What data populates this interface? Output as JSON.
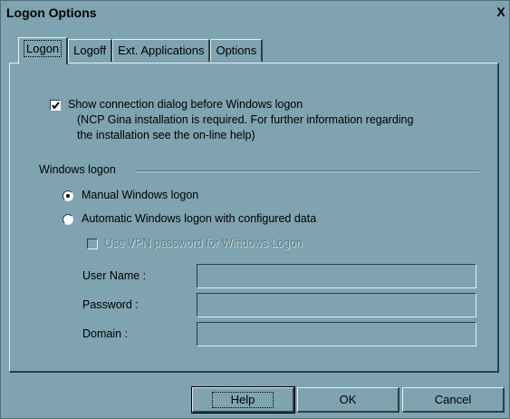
{
  "window": {
    "title": "Logon Options",
    "close_glyph": "X"
  },
  "tabs": [
    {
      "label": "Logon",
      "active": true
    },
    {
      "label": "Logoff",
      "active": false
    },
    {
      "label": "Ext. Applications",
      "active": false
    },
    {
      "label": "Options",
      "active": false
    }
  ],
  "logon": {
    "show_dialog": {
      "label": "Show connection dialog before Windows logon",
      "checked": true,
      "note_line1": "(NCP Gina installation is required. For further information regarding",
      "note_line2": "the installation see the on-line help)"
    },
    "group_label": "Windows logon",
    "radio_manual": {
      "label": "Manual Windows logon",
      "selected": true
    },
    "radio_auto": {
      "label": "Automatic Windows logon with configured data",
      "selected": false
    },
    "use_vpn": {
      "label": "Use VPN password for Windows Logon",
      "checked": false,
      "enabled": false
    },
    "fields": {
      "user_name": {
        "label": "User Name :",
        "value": ""
      },
      "password": {
        "label": "Password :",
        "value": ""
      },
      "domain": {
        "label": "Domain :",
        "value": ""
      }
    }
  },
  "buttons": {
    "help": "Help",
    "ok": "OK",
    "cancel": "Cancel"
  },
  "colors": {
    "face": "#7fa3b0",
    "shadow": "#2b3f46",
    "highlight": "#e6f0f3"
  }
}
